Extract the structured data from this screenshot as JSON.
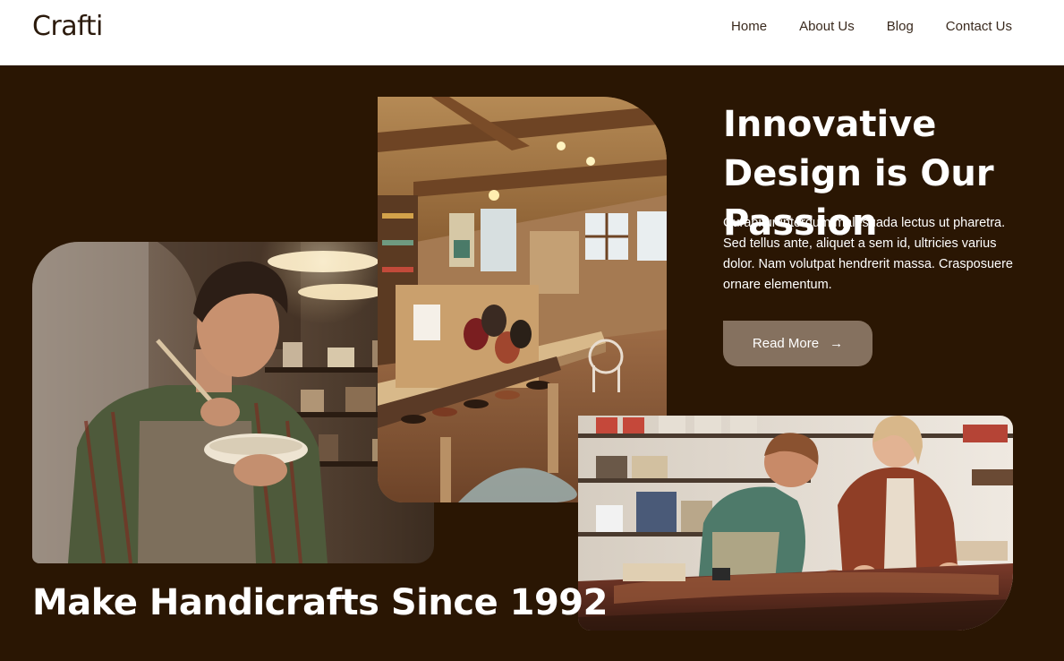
{
  "brand": {
    "logo": "Crafti"
  },
  "nav": {
    "items": [
      {
        "label": "Home"
      },
      {
        "label": "About Us"
      },
      {
        "label": "Blog"
      },
      {
        "label": "Contact Us"
      }
    ]
  },
  "hero": {
    "headline": "Innovative Design is Our Passion",
    "blurb": "Curabitur interdum malesuada lectus ut pharetra. Sed tellus ante, aliquet a sem id, ultricies varius dolor. Nam volutpat hendrerit massa. Crasposuere ornare elementum.",
    "cta_label": "Read More",
    "cta_icon": "arrow-right-icon",
    "tagline": "Make Handicrafts Since 1992"
  },
  "colors": {
    "hero_background": "#2a1603",
    "cta_background": "#85715f",
    "header_background": "#ffffff"
  }
}
